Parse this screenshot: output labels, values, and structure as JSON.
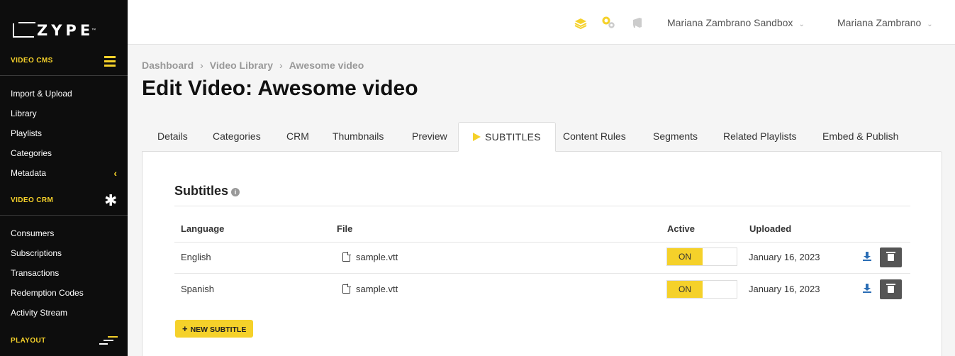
{
  "app": {
    "logo_text": "ZYPE",
    "logo_tm": "™"
  },
  "sidebar": {
    "video_cms": {
      "title": "VIDEO CMS",
      "items": [
        "Import & Upload",
        "Library",
        "Playlists",
        "Categories",
        "Metadata"
      ]
    },
    "video_crm": {
      "title": "VIDEO CRM",
      "items": [
        "Consumers",
        "Subscriptions",
        "Transactions",
        "Redemption Codes",
        "Activity Stream"
      ]
    },
    "playout": {
      "title": "PLAYOUT"
    }
  },
  "topbar": {
    "account_menu": "Mariana Zambrano Sandbox",
    "user_menu": "Mariana Zambrano",
    "caret": "⌄"
  },
  "breadcrumb": [
    "Dashboard",
    "Video Library",
    "Awesome video"
  ],
  "breadcrumb_sep": "›",
  "page_title": "Edit Video: Awesome video",
  "tabs": [
    "Details",
    "Categories",
    "CRM",
    "Thumbnails",
    "Preview",
    "SUBTITLES",
    "Content Rules",
    "Segments",
    "Related Playlists",
    "Embed & Publish"
  ],
  "active_tab": "SUBTITLES",
  "subtitles": {
    "title": "Subtitles",
    "info": "i",
    "columns": {
      "language": "Language",
      "file": "File",
      "active": "Active",
      "uploaded": "Uploaded"
    },
    "rows": [
      {
        "language": "English",
        "file": "sample.vtt",
        "active": "ON",
        "uploaded": "January 16, 2023"
      },
      {
        "language": "Spanish",
        "file": "sample.vtt",
        "active": "ON",
        "uploaded": "January 16, 2023"
      }
    ],
    "new_button": "NEW SUBTITLE",
    "new_button_plus": "+"
  },
  "colors": {
    "accent": "#f5d12a",
    "sidebar_bg": "#0d0d0d",
    "link_icon": "#2a6db5"
  }
}
